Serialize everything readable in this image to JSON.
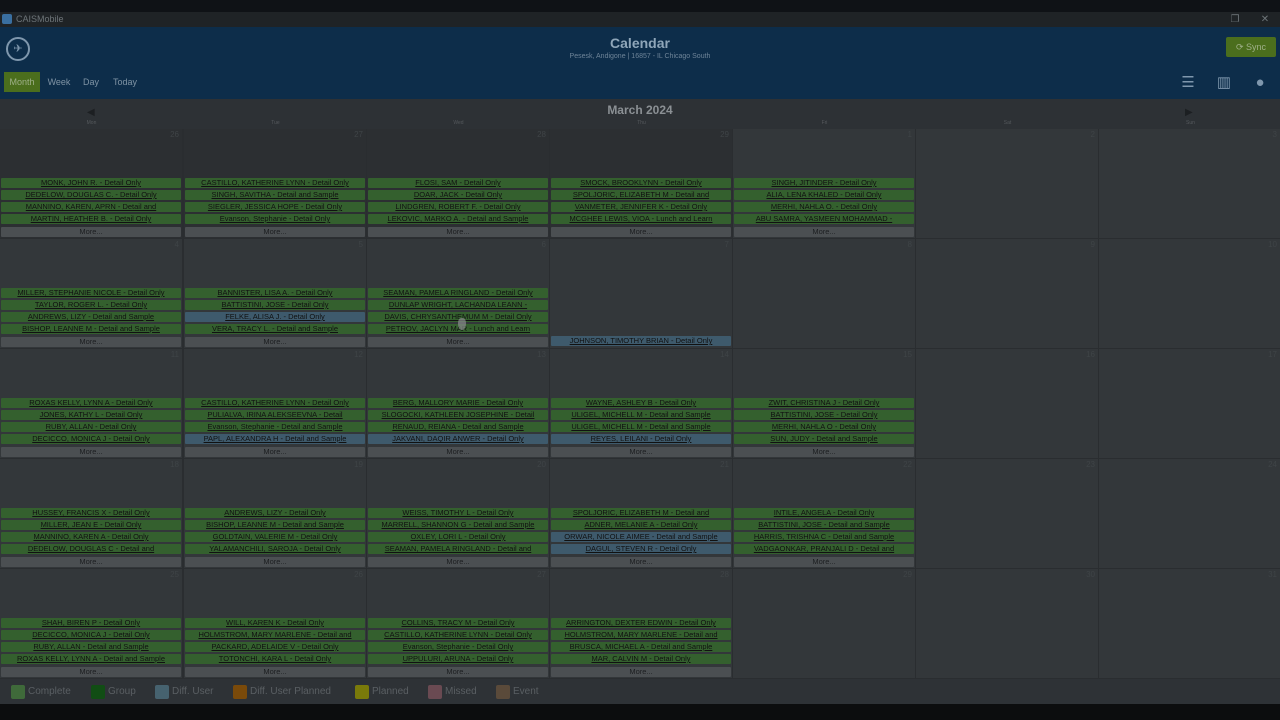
{
  "window": {
    "title": "CAISMobile",
    "controls": [
      "❐",
      "✕"
    ]
  },
  "header": {
    "title": "Calendar",
    "subtitle": "Pesesk, Andigone | 16857 - IL Chicago South",
    "sync_label": "Sync",
    "views": [
      "Month",
      "Week",
      "Day",
      "Today"
    ]
  },
  "calendar": {
    "month_label": "March 2024",
    "weekdays": [
      "Mon",
      "Tue",
      "Wed",
      "Thu",
      "Fri",
      "Sat",
      "Sun"
    ],
    "weeks": [
      {
        "days": [
          {
            "num": "26",
            "greyed": true,
            "events": [
              {
                "text": "MONK, JOHN R. - Detail Only",
                "type": "complete"
              },
              {
                "text": "DEDELOW, DOUGLAS C. - Detail Only",
                "type": "complete"
              },
              {
                "text": "MANNINO, KAREN, APRN - Detail and",
                "type": "complete"
              },
              {
                "text": "MARTIN, HEATHER B. - Detail Only",
                "type": "complete"
              }
            ],
            "more": "More..."
          },
          {
            "num": "27",
            "greyed": true,
            "events": [
              {
                "text": "CASTILLO, KATHERINE LYNN - Detail Only",
                "type": "complete"
              },
              {
                "text": "SINGH, SAVITHA - Detail and Sample",
                "type": "complete"
              },
              {
                "text": "SIEGLER, JESSICA HOPE - Detail Only",
                "type": "complete"
              },
              {
                "text": "Evanson, Stephanie - Detail Only",
                "type": "complete"
              }
            ],
            "more": "More..."
          },
          {
            "num": "28",
            "greyed": true,
            "events": [
              {
                "text": "FLOSI, SAM - Detail Only",
                "type": "complete"
              },
              {
                "text": "DOAR, JACK - Detail Only",
                "type": "complete"
              },
              {
                "text": "LINDGREN, ROBERT F. - Detail Only",
                "type": "complete"
              },
              {
                "text": "LEKOVIC, MARKO A. - Detail and Sample",
                "type": "complete"
              }
            ],
            "more": "More..."
          },
          {
            "num": "29",
            "greyed": true,
            "events": [
              {
                "text": "SMOCK, BROOKLYNN - Detail Only",
                "type": "complete"
              },
              {
                "text": "SPOLJORIC, ELIZABETH M - Detail and",
                "type": "complete"
              },
              {
                "text": "VANMETER, JENNIFER K - Detail Only",
                "type": "complete"
              },
              {
                "text": "MCGHEE LEWIS, VIOA - Lunch and Learn",
                "type": "complete"
              }
            ],
            "more": "More..."
          },
          {
            "num": "1",
            "greyed": false,
            "events": [
              {
                "text": "SINGH, JITINDER - Detail Only",
                "type": "complete"
              },
              {
                "text": "ALIA, LENA KHALED - Detail Only",
                "type": "complete"
              },
              {
                "text": "MERHI, NAHLA O. - Detail Only",
                "type": "complete"
              },
              {
                "text": "ABU SAMRA, YASMEEN MOHAMMAD -",
                "type": "complete"
              }
            ],
            "more": "More..."
          },
          {
            "num": "2",
            "greyed": false,
            "events": [],
            "more": ""
          },
          {
            "num": "3",
            "greyed": false,
            "events": [],
            "more": ""
          }
        ]
      },
      {
        "days": [
          {
            "num": "4",
            "greyed": false,
            "events": [
              {
                "text": "MILLER, STEPHANIE NICOLE - Detail Only",
                "type": "complete"
              },
              {
                "text": "TAYLOR, ROGER L. - Detail Only",
                "type": "complete"
              },
              {
                "text": "ANDREWS, LIZY - Detail and Sample",
                "type": "complete"
              },
              {
                "text": "BISHOP, LEANNE M - Detail and Sample",
                "type": "complete"
              }
            ],
            "more": "More..."
          },
          {
            "num": "5",
            "greyed": false,
            "events": [
              {
                "text": "BANNISTER, LISA A. - Detail Only",
                "type": "complete"
              },
              {
                "text": "BATTISTINI, JOSE - Detail Only",
                "type": "complete"
              },
              {
                "text": "FELKE, ALISA J. - Detail Only",
                "type": "diffuser"
              },
              {
                "text": "VERA, TRACY L. - Detail and Sample",
                "type": "complete"
              }
            ],
            "more": "More..."
          },
          {
            "num": "6",
            "greyed": false,
            "events": [
              {
                "text": "SEAMAN, PAMELA RINGLAND - Detail Only",
                "type": "complete"
              },
              {
                "text": "DUNLAP WRIGHT, LACHANDA LEANN -",
                "type": "complete"
              },
              {
                "text": "DAVIS, CHRYSANTHEMUM M - Detail Only",
                "type": "complete"
              },
              {
                "text": "PETROV, JACLYN MAR - Lunch and Learn",
                "type": "complete"
              }
            ],
            "more": "More..."
          },
          {
            "num": "7",
            "greyed": false,
            "events": [
              {
                "text": "",
                "type": "empty"
              },
              {
                "text": "",
                "type": "empty"
              },
              {
                "text": "",
                "type": "empty"
              },
              {
                "text": "",
                "type": "empty"
              },
              {
                "text": "JOHNSON, TIMOTHY BRIAN - Detail Only",
                "type": "diffuser"
              }
            ],
            "more": ""
          },
          {
            "num": "8",
            "greyed": false,
            "events": [],
            "more": ""
          },
          {
            "num": "9",
            "greyed": false,
            "events": [],
            "more": ""
          },
          {
            "num": "10",
            "greyed": false,
            "events": [],
            "more": ""
          }
        ]
      },
      {
        "days": [
          {
            "num": "11",
            "greyed": false,
            "events": [
              {
                "text": "ROXAS KELLY, LYNN A - Detail Only",
                "type": "complete"
              },
              {
                "text": "JONES, KATHY L - Detail Only",
                "type": "complete"
              },
              {
                "text": "RUBY, ALLAN - Detail Only",
                "type": "complete"
              },
              {
                "text": "DECICCO, MONICA J - Detail Only",
                "type": "complete"
              }
            ],
            "more": "More..."
          },
          {
            "num": "12",
            "greyed": false,
            "events": [
              {
                "text": "CASTILLO, KATHERINE LYNN - Detail Only",
                "type": "complete"
              },
              {
                "text": "PULIALVA, IRINA ALEKSEEVNA - Detail",
                "type": "complete"
              },
              {
                "text": "Evanson, Stephanie - Detail and Sample",
                "type": "complete"
              },
              {
                "text": "PAPL, ALEXANDRA H - Detail and Sample",
                "type": "diffuser"
              }
            ],
            "more": "More..."
          },
          {
            "num": "13",
            "greyed": false,
            "events": [
              {
                "text": "BERG, MALLORY MARIE - Detail Only",
                "type": "complete"
              },
              {
                "text": "SLOGOCKI, KATHLEEN JOSEPHINE - Detail",
                "type": "complete"
              },
              {
                "text": "RENAUD, REIANA - Detail and Sample",
                "type": "complete"
              },
              {
                "text": "JAKVANI, DAQIR ANWER - Detail Only",
                "type": "diffuser"
              }
            ],
            "more": "More..."
          },
          {
            "num": "14",
            "greyed": false,
            "events": [
              {
                "text": "WAYNE, ASHLEY B - Detail Only",
                "type": "complete"
              },
              {
                "text": "ULIGEL, MICHELL M - Detail and Sample",
                "type": "complete"
              },
              {
                "text": "ULIGEL, MICHELL M - Detail and Sample",
                "type": "complete"
              },
              {
                "text": "REYES, LEILANI - Detail Only",
                "type": "diffuser"
              }
            ],
            "more": "More..."
          },
          {
            "num": "15",
            "greyed": false,
            "events": [
              {
                "text": "ZWIT, CHRISTINA J - Detail Only",
                "type": "complete"
              },
              {
                "text": "BATTISTINI, JOSE - Detail Only",
                "type": "complete"
              },
              {
                "text": "MERHI, NAHLA O - Detail Only",
                "type": "complete"
              },
              {
                "text": "SUN, JUDY - Detail and Sample",
                "type": "complete"
              }
            ],
            "more": "More..."
          },
          {
            "num": "16",
            "greyed": false,
            "events": [],
            "more": ""
          },
          {
            "num": "17",
            "greyed": false,
            "events": [],
            "more": ""
          }
        ]
      },
      {
        "days": [
          {
            "num": "18",
            "greyed": false,
            "events": [
              {
                "text": "HUSSEY, FRANCIS X - Detail Only",
                "type": "complete"
              },
              {
                "text": "MILLER, JEAN E - Detail Only",
                "type": "complete"
              },
              {
                "text": "MANNINO, KAREN A - Detail Only",
                "type": "complete"
              },
              {
                "text": "DEDELOW, DOUGLAS C - Detail and",
                "type": "complete"
              }
            ],
            "more": "More..."
          },
          {
            "num": "19",
            "greyed": false,
            "events": [
              {
                "text": "ANDREWS, LIZY - Detail Only",
                "type": "complete"
              },
              {
                "text": "BISHOP, LEANNE M - Detail and Sample",
                "type": "complete"
              },
              {
                "text": "GOLDTAIN, VALERIE M - Detail Only",
                "type": "complete"
              },
              {
                "text": "YALAMANCHILI, SAROJA - Detail Only",
                "type": "complete"
              }
            ],
            "more": "More..."
          },
          {
            "num": "20",
            "greyed": false,
            "events": [
              {
                "text": "WEISS, TIMOTHY L - Detail Only",
                "type": "complete"
              },
              {
                "text": "MARRELL, SHANNON G - Detail and Sample",
                "type": "complete"
              },
              {
                "text": "OXLEY, LORI L - Detail Only",
                "type": "complete"
              },
              {
                "text": "SEAMAN, PAMELA RINGLAND - Detail and",
                "type": "complete"
              }
            ],
            "more": "More..."
          },
          {
            "num": "21",
            "greyed": false,
            "events": [
              {
                "text": "SPOLJORIC, ELIZABETH M - Detail and",
                "type": "complete"
              },
              {
                "text": "ADNER, MELANIE A - Detail Only",
                "type": "complete"
              },
              {
                "text": "ORWAR, NICOLE AIMEE - Detail and Sample",
                "type": "diffuser"
              },
              {
                "text": "DAGUL, STEVEN R - Detail Only",
                "type": "diffuser"
              }
            ],
            "more": "More..."
          },
          {
            "num": "22",
            "greyed": false,
            "events": [
              {
                "text": "INTILE, ANGELA - Detail Only",
                "type": "complete"
              },
              {
                "text": "BATTISTINI, JOSE - Detail and Sample",
                "type": "complete"
              },
              {
                "text": "HARRIS, TRISHNA C - Detail and Sample",
                "type": "complete"
              },
              {
                "text": "VADGAONKAR, PRANJALI D - Detail and",
                "type": "complete"
              }
            ],
            "more": "More..."
          },
          {
            "num": "23",
            "greyed": false,
            "events": [],
            "more": ""
          },
          {
            "num": "24",
            "greyed": false,
            "events": [],
            "more": ""
          }
        ]
      },
      {
        "days": [
          {
            "num": "25",
            "greyed": false,
            "events": [
              {
                "text": "SHAH, BIREN P - Detail Only",
                "type": "complete"
              },
              {
                "text": "DECICCO, MONICA J - Detail Only",
                "type": "complete"
              },
              {
                "text": "RUBY, ALLAN - Detail and Sample",
                "type": "complete"
              },
              {
                "text": "ROXAS KELLY, LYNN A - Detail and Sample",
                "type": "complete"
              }
            ],
            "more": "More..."
          },
          {
            "num": "26",
            "greyed": false,
            "events": [
              {
                "text": "WILL, KAREN K - Detail Only",
                "type": "complete"
              },
              {
                "text": "HOLMSTROM, MARY MARLENE - Detail and",
                "type": "complete"
              },
              {
                "text": "PACKARD, ADELAIDE V - Detail Only",
                "type": "complete"
              },
              {
                "text": "TOTONCHI, KARA L - Detail Only",
                "type": "complete"
              }
            ],
            "more": "More..."
          },
          {
            "num": "27",
            "greyed": false,
            "events": [
              {
                "text": "COLLINS, TRACY M - Detail Only",
                "type": "complete"
              },
              {
                "text": "CASTILLO, KATHERINE LYNN - Detail Only",
                "type": "complete"
              },
              {
                "text": "Evanson, Stephanie - Detail Only",
                "type": "complete"
              },
              {
                "text": "UPPULURI, ARUNA - Detail Only",
                "type": "complete"
              }
            ],
            "more": "More..."
          },
          {
            "num": "28",
            "greyed": false,
            "events": [
              {
                "text": "ARRINGTON, DEXTER EDWIN - Detail Only",
                "type": "complete"
              },
              {
                "text": "HOLMSTROM, MARY MARLENE - Detail and",
                "type": "complete"
              },
              {
                "text": "BRUSCA, MICHAEL A - Detail and Sample",
                "type": "complete"
              },
              {
                "text": "MAR, CALVIN M - Detail Only",
                "type": "complete"
              }
            ],
            "more": "More..."
          },
          {
            "num": "29",
            "greyed": false,
            "events": [],
            "more": ""
          },
          {
            "num": "30",
            "greyed": false,
            "events": [],
            "more": ""
          },
          {
            "num": "31",
            "greyed": false,
            "events": [],
            "more": ""
          }
        ]
      }
    ]
  },
  "legend": [
    {
      "label": "Complete",
      "color": "#3f6a3a"
    },
    {
      "label": "Group",
      "color": "#114d14"
    },
    {
      "label": "Diff. User",
      "color": "#46626f"
    },
    {
      "label": "Diff. User Planned",
      "color": "#7a4a0a"
    },
    {
      "label": "Planned",
      "color": "#7a7a0a"
    },
    {
      "label": "Missed",
      "color": "#6a4a52"
    },
    {
      "label": "Event",
      "color": "#5a4a3a"
    }
  ],
  "icons": {
    "logo": "logo-icon",
    "sync": "sync-icon",
    "prev": "prev-month-icon",
    "next": "next-month-icon",
    "notes": "notes-icon",
    "map": "map-icon",
    "user": "user-icon"
  }
}
